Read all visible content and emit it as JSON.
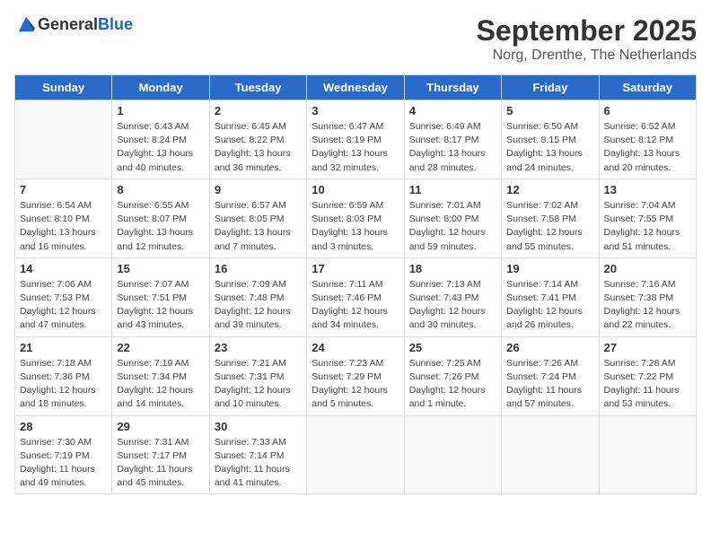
{
  "header": {
    "logo_general": "General",
    "logo_blue": "Blue",
    "month": "September 2025",
    "location": "Norg, Drenthe, The Netherlands"
  },
  "weekdays": [
    "Sunday",
    "Monday",
    "Tuesday",
    "Wednesday",
    "Thursday",
    "Friday",
    "Saturday"
  ],
  "weeks": [
    [
      {
        "day": "",
        "detail": ""
      },
      {
        "day": "1",
        "detail": "Sunrise: 6:43 AM\nSunset: 8:24 PM\nDaylight: 13 hours\nand 40 minutes."
      },
      {
        "day": "2",
        "detail": "Sunrise: 6:45 AM\nSunset: 8:22 PM\nDaylight: 13 hours\nand 36 minutes."
      },
      {
        "day": "3",
        "detail": "Sunrise: 6:47 AM\nSunset: 8:19 PM\nDaylight: 13 hours\nand 32 minutes."
      },
      {
        "day": "4",
        "detail": "Sunrise: 6:49 AM\nSunset: 8:17 PM\nDaylight: 13 hours\nand 28 minutes."
      },
      {
        "day": "5",
        "detail": "Sunrise: 6:50 AM\nSunset: 8:15 PM\nDaylight: 13 hours\nand 24 minutes."
      },
      {
        "day": "6",
        "detail": "Sunrise: 6:52 AM\nSunset: 8:12 PM\nDaylight: 13 hours\nand 20 minutes."
      }
    ],
    [
      {
        "day": "7",
        "detail": "Sunrise: 6:54 AM\nSunset: 8:10 PM\nDaylight: 13 hours\nand 16 minutes."
      },
      {
        "day": "8",
        "detail": "Sunrise: 6:55 AM\nSunset: 8:07 PM\nDaylight: 13 hours\nand 12 minutes."
      },
      {
        "day": "9",
        "detail": "Sunrise: 6:57 AM\nSunset: 8:05 PM\nDaylight: 13 hours\nand 7 minutes."
      },
      {
        "day": "10",
        "detail": "Sunrise: 6:59 AM\nSunset: 8:03 PM\nDaylight: 13 hours\nand 3 minutes."
      },
      {
        "day": "11",
        "detail": "Sunrise: 7:01 AM\nSunset: 8:00 PM\nDaylight: 12 hours\nand 59 minutes."
      },
      {
        "day": "12",
        "detail": "Sunrise: 7:02 AM\nSunset: 7:58 PM\nDaylight: 12 hours\nand 55 minutes."
      },
      {
        "day": "13",
        "detail": "Sunrise: 7:04 AM\nSunset: 7:55 PM\nDaylight: 12 hours\nand 51 minutes."
      }
    ],
    [
      {
        "day": "14",
        "detail": "Sunrise: 7:06 AM\nSunset: 7:53 PM\nDaylight: 12 hours\nand 47 minutes."
      },
      {
        "day": "15",
        "detail": "Sunrise: 7:07 AM\nSunset: 7:51 PM\nDaylight: 12 hours\nand 43 minutes."
      },
      {
        "day": "16",
        "detail": "Sunrise: 7:09 AM\nSunset: 7:48 PM\nDaylight: 12 hours\nand 39 minutes."
      },
      {
        "day": "17",
        "detail": "Sunrise: 7:11 AM\nSunset: 7:46 PM\nDaylight: 12 hours\nand 34 minutes."
      },
      {
        "day": "18",
        "detail": "Sunrise: 7:13 AM\nSunset: 7:43 PM\nDaylight: 12 hours\nand 30 minutes."
      },
      {
        "day": "19",
        "detail": "Sunrise: 7:14 AM\nSunset: 7:41 PM\nDaylight: 12 hours\nand 26 minutes."
      },
      {
        "day": "20",
        "detail": "Sunrise: 7:16 AM\nSunset: 7:38 PM\nDaylight: 12 hours\nand 22 minutes."
      }
    ],
    [
      {
        "day": "21",
        "detail": "Sunrise: 7:18 AM\nSunset: 7:36 PM\nDaylight: 12 hours\nand 18 minutes."
      },
      {
        "day": "22",
        "detail": "Sunrise: 7:19 AM\nSunset: 7:34 PM\nDaylight: 12 hours\nand 14 minutes."
      },
      {
        "day": "23",
        "detail": "Sunrise: 7:21 AM\nSunset: 7:31 PM\nDaylight: 12 hours\nand 10 minutes."
      },
      {
        "day": "24",
        "detail": "Sunrise: 7:23 AM\nSunset: 7:29 PM\nDaylight: 12 hours\nand 5 minutes."
      },
      {
        "day": "25",
        "detail": "Sunrise: 7:25 AM\nSunset: 7:26 PM\nDaylight: 12 hours\nand 1 minute."
      },
      {
        "day": "26",
        "detail": "Sunrise: 7:26 AM\nSunset: 7:24 PM\nDaylight: 11 hours\nand 57 minutes."
      },
      {
        "day": "27",
        "detail": "Sunrise: 7:28 AM\nSunset: 7:22 PM\nDaylight: 11 hours\nand 53 minutes."
      }
    ],
    [
      {
        "day": "28",
        "detail": "Sunrise: 7:30 AM\nSunset: 7:19 PM\nDaylight: 11 hours\nand 49 minutes."
      },
      {
        "day": "29",
        "detail": "Sunrise: 7:31 AM\nSunset: 7:17 PM\nDaylight: 11 hours\nand 45 minutes."
      },
      {
        "day": "30",
        "detail": "Sunrise: 7:33 AM\nSunset: 7:14 PM\nDaylight: 11 hours\nand 41 minutes."
      },
      {
        "day": "",
        "detail": ""
      },
      {
        "day": "",
        "detail": ""
      },
      {
        "day": "",
        "detail": ""
      },
      {
        "day": "",
        "detail": ""
      }
    ]
  ]
}
